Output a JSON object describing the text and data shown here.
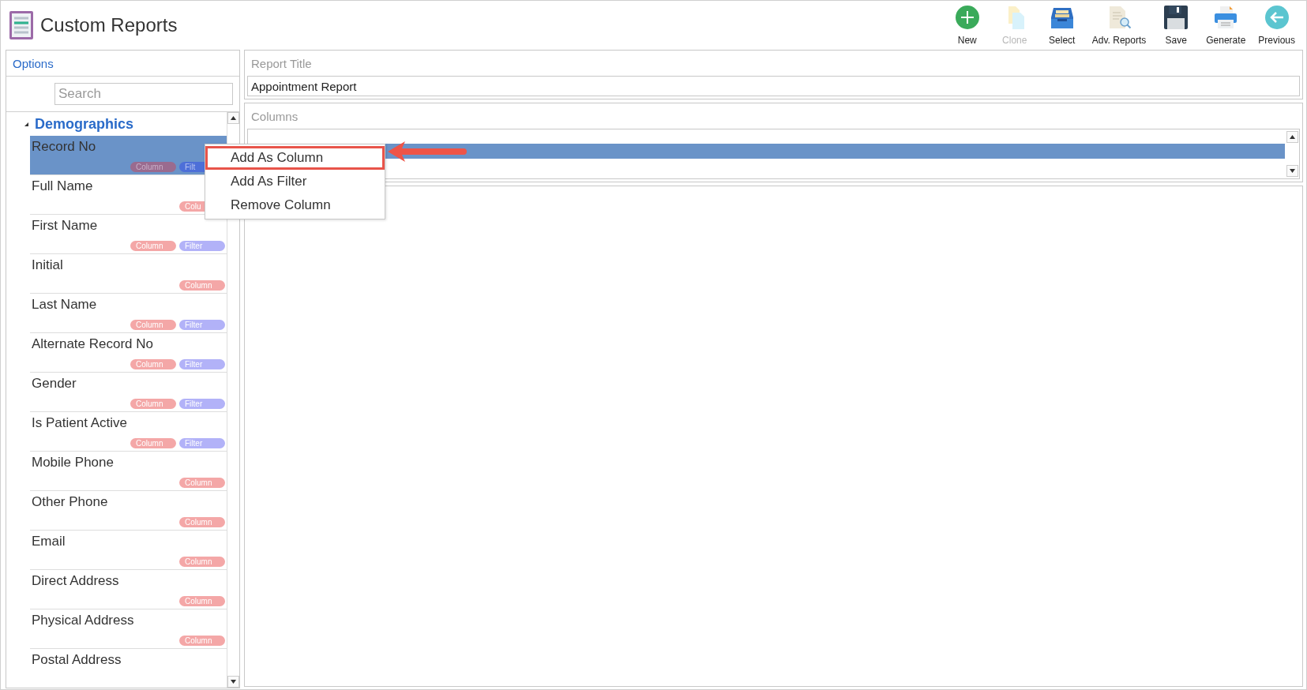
{
  "header": {
    "title": "Custom Reports"
  },
  "toolbar": [
    {
      "kind": "new",
      "label": "New",
      "disabled": false
    },
    {
      "kind": "clone",
      "label": "Clone",
      "disabled": true
    },
    {
      "kind": "select",
      "label": "Select",
      "disabled": false
    },
    {
      "kind": "adv",
      "label": "Adv. Reports",
      "disabled": false
    },
    {
      "kind": "save",
      "label": "Save",
      "disabled": false
    },
    {
      "kind": "generate",
      "label": "Generate",
      "disabled": false
    },
    {
      "kind": "previous",
      "label": "Previous",
      "disabled": false
    }
  ],
  "options": {
    "title": "Options",
    "search": {
      "placeholder": "Search"
    },
    "groups": [
      {
        "label": "Demographics",
        "expanded": true,
        "children": [
          {
            "label": "Record No",
            "selected": true,
            "badges": [
              {
                "kind": "column",
                "text": "Column"
              },
              {
                "kind": "filter",
                "text": "Filt"
              }
            ]
          },
          {
            "label": "Full Name",
            "selected": false,
            "badges": [
              {
                "kind": "column",
                "text": "Colu"
              }
            ]
          },
          {
            "label": "First Name",
            "selected": false,
            "badges": [
              {
                "kind": "column",
                "text": "Column"
              },
              {
                "kind": "filter",
                "text": "Filter"
              }
            ]
          },
          {
            "label": "Initial",
            "selected": false,
            "badges": [
              {
                "kind": "column",
                "text": "Column"
              }
            ]
          },
          {
            "label": "Last Name",
            "selected": false,
            "badges": [
              {
                "kind": "column",
                "text": "Column"
              },
              {
                "kind": "filter",
                "text": "Filter"
              }
            ]
          },
          {
            "label": "Alternate Record No",
            "selected": false,
            "badges": [
              {
                "kind": "column",
                "text": "Column"
              },
              {
                "kind": "filter",
                "text": "Filter"
              }
            ]
          },
          {
            "label": "Gender",
            "selected": false,
            "badges": [
              {
                "kind": "column",
                "text": "Column"
              },
              {
                "kind": "filter",
                "text": "Filter"
              }
            ]
          },
          {
            "label": "Is Patient Active",
            "selected": false,
            "badges": [
              {
                "kind": "column",
                "text": "Column"
              },
              {
                "kind": "filter",
                "text": "Filter"
              }
            ]
          },
          {
            "label": "Mobile Phone",
            "selected": false,
            "badges": [
              {
                "kind": "column",
                "text": "Column"
              }
            ]
          },
          {
            "label": "Other Phone",
            "selected": false,
            "badges": [
              {
                "kind": "column",
                "text": "Column"
              }
            ]
          },
          {
            "label": "Email",
            "selected": false,
            "badges": [
              {
                "kind": "column",
                "text": "Column"
              }
            ]
          },
          {
            "label": "Direct Address",
            "selected": false,
            "badges": [
              {
                "kind": "column",
                "text": "Column"
              }
            ]
          },
          {
            "label": "Physical Address",
            "selected": false,
            "badges": [
              {
                "kind": "column",
                "text": "Column"
              }
            ]
          },
          {
            "label": "Postal Address",
            "selected": false
          }
        ]
      }
    ]
  },
  "report_title": {
    "label": "Report Title",
    "value": "Appointment Report"
  },
  "columns": {
    "label": "Columns",
    "rows": [
      {
        "selected": true
      }
    ]
  },
  "context_menu": [
    {
      "label": "Add As Column",
      "annotated": true
    },
    {
      "label": "Add As Filter",
      "annotated": false
    },
    {
      "label": "Remove Column",
      "annotated": false
    }
  ]
}
